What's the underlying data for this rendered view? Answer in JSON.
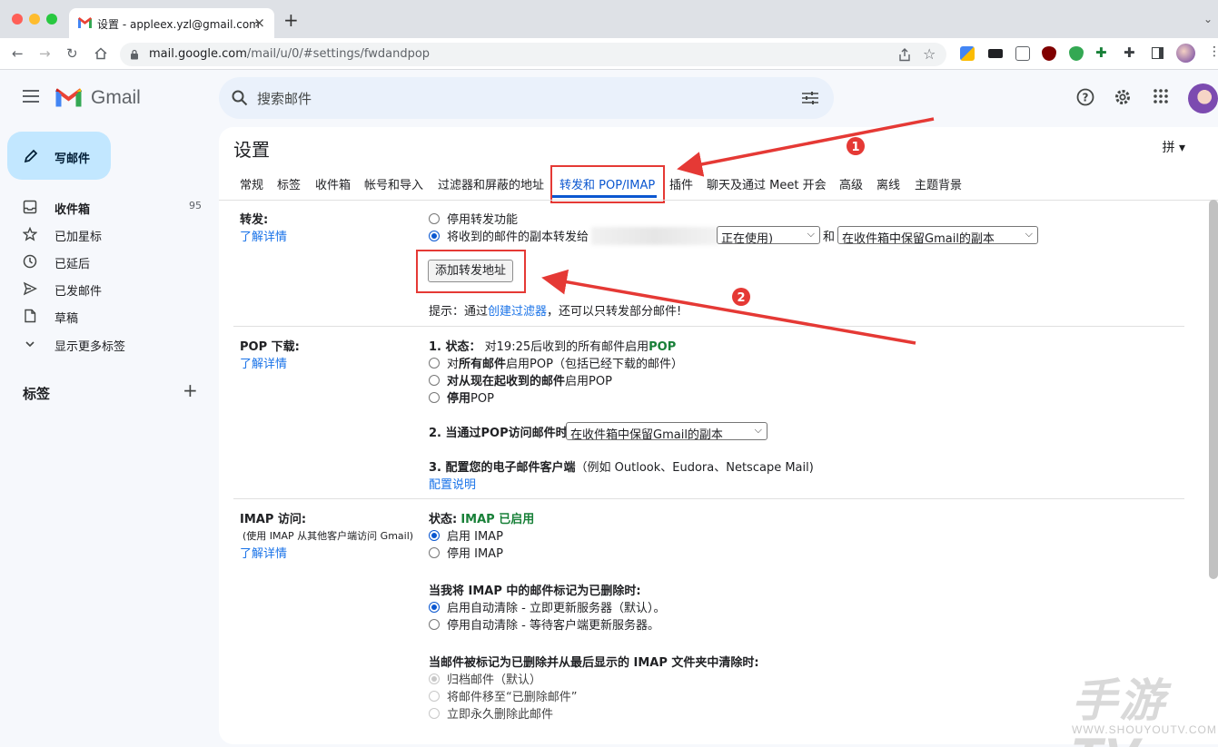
{
  "browser": {
    "tab_title": "设置 - appleex.yzl@gmail.com",
    "new_tab": "+",
    "tab_menu": "⌄",
    "url_host": "mail.google.com",
    "url_path": "/mail/u/0/#settings/fwdandpop",
    "close": "×"
  },
  "gmail": {
    "brand": "Gmail",
    "search_placeholder": "搜索邮件",
    "compose": "写邮件",
    "nav": [
      {
        "label": "收件箱",
        "count": "95",
        "icon": "inbox-icon",
        "bold": true
      },
      {
        "label": "已加星标",
        "count": "",
        "icon": "star-icon"
      },
      {
        "label": "已延后",
        "count": "",
        "icon": "clock-icon"
      },
      {
        "label": "已发邮件",
        "count": "",
        "icon": "send-icon"
      },
      {
        "label": "草稿",
        "count": "",
        "icon": "draft-icon"
      },
      {
        "label": "显示更多标签",
        "count": "",
        "icon": "chevron-down-icon"
      }
    ],
    "labels_heading": "标签",
    "labels_add": "+"
  },
  "settings": {
    "title": "设置",
    "input_method": "拼 ▾",
    "tabs": [
      "常规",
      "标签",
      "收件箱",
      "帐号和导入",
      "过滤器和屏蔽的地址",
      "转发和 POP/IMAP",
      "插件",
      "聊天及通过 Meet 开会",
      "高级",
      "离线",
      "主题背景"
    ],
    "active_tab": 5,
    "forwarding": {
      "label": "转发:",
      "learn_more": "了解详情",
      "opt_disable": "停用转发功能",
      "opt_forward": "将收到的邮件的副本转发给",
      "forward_select_tail": "正在使用)",
      "and": "和",
      "keep_select": "在收件箱中保留Gmail的副本",
      "add_button": "添加转发地址",
      "tip_prefix": "提示：通过",
      "tip_link": "创建过滤器",
      "tip_suffix": "，还可以只转发部分邮件!"
    },
    "pop": {
      "label": "POP 下载:",
      "learn_more": "了解详情",
      "status_label": "1. 状态：",
      "status_text": "对19:25后收到的所有邮件启用",
      "status_value": "POP",
      "opt_all_a": "对",
      "opt_all_b": "所有邮件",
      "opt_all_c": "启用POP（包括已经下载的邮件）",
      "opt_now_a": "对从现在起收到的邮件",
      "opt_now_b": "启用POP",
      "opt_disable_a": "停用",
      "opt_disable_b": "POP",
      "access_label": "2. 当通过POP访问邮件时",
      "access_select": "在收件箱中保留Gmail的副本",
      "client_label": "3. 配置您的电子邮件客户端",
      "client_examples": "（例如 Outlook、Eudora、Netscape Mail)",
      "config_link": "配置说明"
    },
    "imap": {
      "label": "IMAP 访问:",
      "sublabel": "(使用 IMAP 从其他客户端访问 Gmail)",
      "learn_more": "了解详情",
      "status_label": "状态:",
      "status_value": "IMAP 已启用",
      "opt_enable": "启用 IMAP",
      "opt_disable": "停用 IMAP",
      "deleted_heading": "当我将 IMAP 中的邮件标记为已删除时:",
      "opt_autoexp_on": "启用自动清除 - 立即更新服务器（默认）。",
      "opt_autoexp_off": "停用自动清除 - 等待客户端更新服务器。",
      "expunge_heading": "当邮件被标记为已删除并从最后显示的 IMAP 文件夹中清除时:",
      "opt_archive": "归档邮件（默认）",
      "opt_trash": "将邮件移至“已删除邮件”",
      "opt_delete": "立即永久删除此邮件"
    }
  },
  "annotations": {
    "marker1": "1",
    "marker2": "2",
    "color": "#e53935"
  },
  "watermark": {
    "title": "手游TV",
    "url": "WWW.SHOUYOUTV.COM"
  }
}
